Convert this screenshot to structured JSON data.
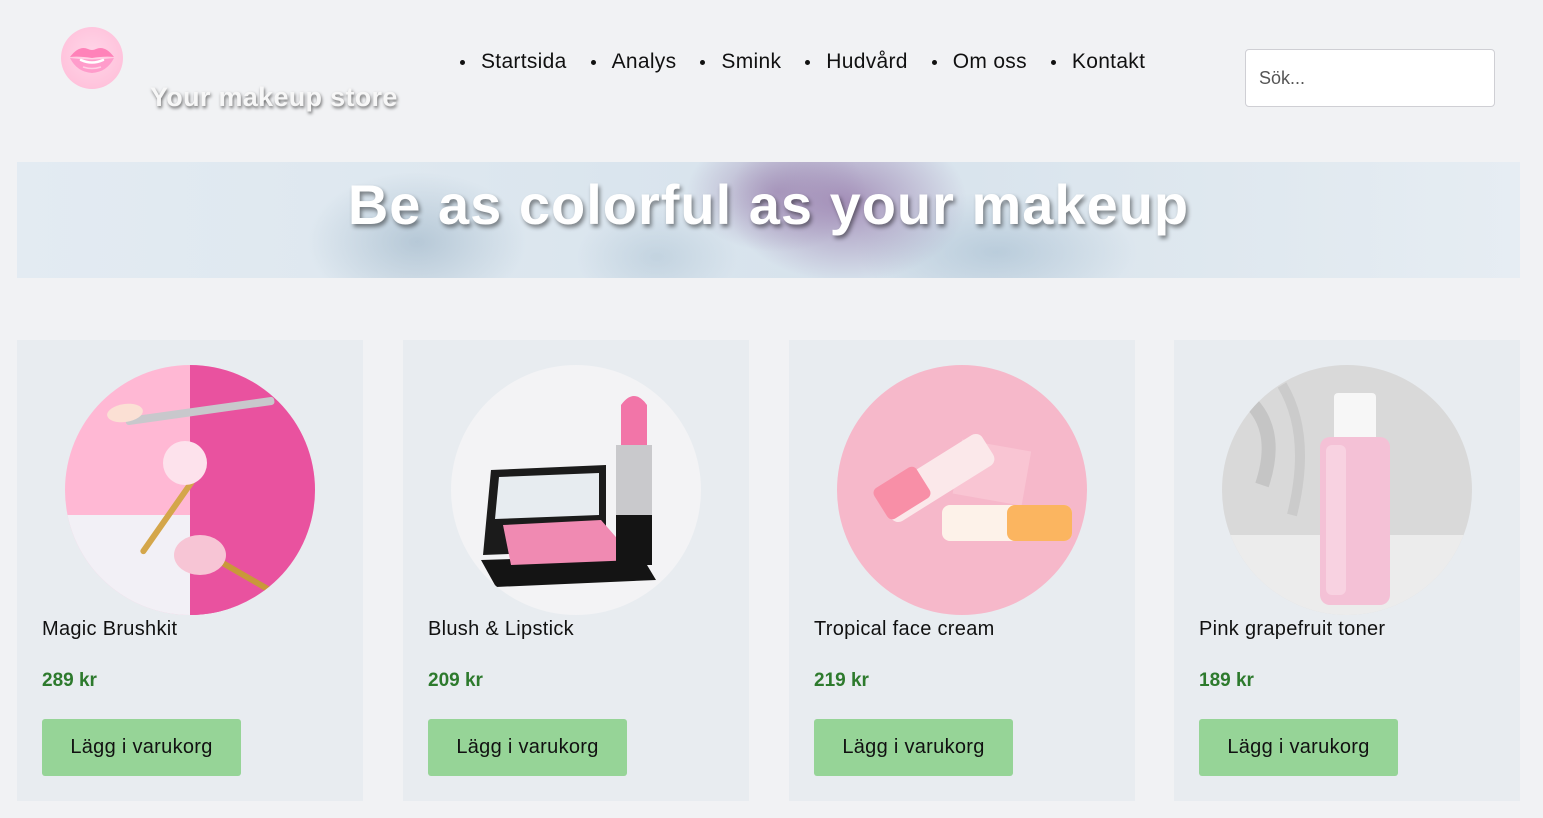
{
  "header": {
    "brand": "Your makeup store",
    "nav": [
      "Startsida",
      "Analys",
      "Smink",
      "Hudvård",
      "Om oss",
      "Kontakt"
    ],
    "search_placeholder": "Sök..."
  },
  "hero": {
    "title": "Be as colorful as your makeup"
  },
  "products": [
    {
      "name": "Magic Brushkit",
      "price": "289 kr",
      "button": "Lägg i varukorg",
      "image_icon": "makeup-brushes"
    },
    {
      "name": "Blush & Lipstick",
      "price": "209 kr",
      "button": "Lägg i varukorg",
      "image_icon": "blush-lipstick"
    },
    {
      "name": "Tropical face cream",
      "price": "219 kr",
      "button": "Lägg i varukorg",
      "image_icon": "cream-tubes"
    },
    {
      "name": "Pink grapefruit toner",
      "price": "189 kr",
      "button": "Lägg i varukorg",
      "image_icon": "toner-bottle"
    }
  ],
  "colors": {
    "page_bg": "#f1f2f4",
    "card_bg": "#e8ecf0",
    "price": "#2d7a2d",
    "button_bg": "#96d497"
  }
}
